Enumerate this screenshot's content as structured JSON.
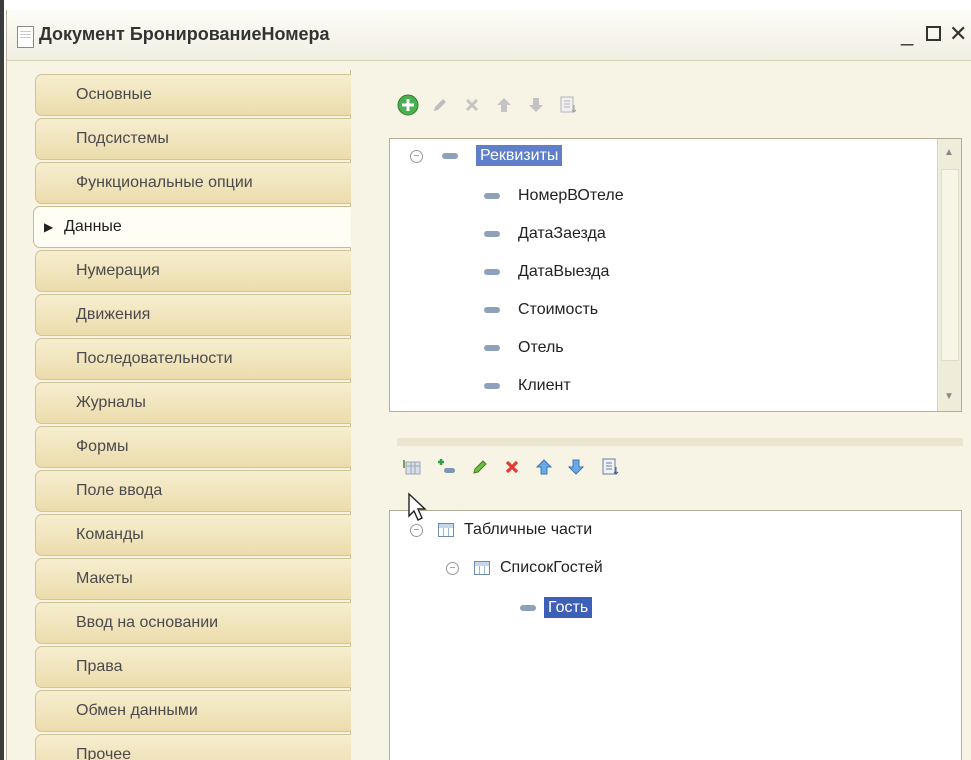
{
  "window": {
    "title": "Документ БронированиеНомера"
  },
  "tabs": [
    {
      "label": "Основные",
      "active": false
    },
    {
      "label": "Подсистемы",
      "active": false
    },
    {
      "label": "Функциональные опции",
      "active": false
    },
    {
      "label": "Данные",
      "active": true
    },
    {
      "label": "Нумерация",
      "active": false
    },
    {
      "label": "Движения",
      "active": false
    },
    {
      "label": "Последовательности",
      "active": false
    },
    {
      "label": "Журналы",
      "active": false
    },
    {
      "label": "Формы",
      "active": false
    },
    {
      "label": "Поле ввода",
      "active": false
    },
    {
      "label": "Команды",
      "active": false
    },
    {
      "label": "Макеты",
      "active": false
    },
    {
      "label": "Ввод на основании",
      "active": false
    },
    {
      "label": "Права",
      "active": false
    },
    {
      "label": "Обмен данными",
      "active": false
    },
    {
      "label": "Прочее",
      "active": false
    }
  ],
  "attributes_tree": {
    "root": "Реквизиты",
    "items": [
      "НомерВОтеле",
      "ДатаЗаезда",
      "ДатаВыезда",
      "Стоимость",
      "Отель",
      "Клиент"
    ]
  },
  "tabular_tree": {
    "root": "Табличные части",
    "table": "СписокГостей",
    "field": "Гость"
  },
  "icons": {
    "add": "add-circle-icon",
    "add_child": "add-child-icon",
    "edit": "pencil-icon",
    "delete": "delete-icon",
    "move_up": "arrow-up-icon",
    "move_down": "arrow-down-icon",
    "sort": "sort-list-icon",
    "add_table": "add-table-icon"
  },
  "colors": {
    "selection": "#3d5fb8",
    "tab_bg": "#ecdcac",
    "window_bg": "#f7f4e6"
  }
}
